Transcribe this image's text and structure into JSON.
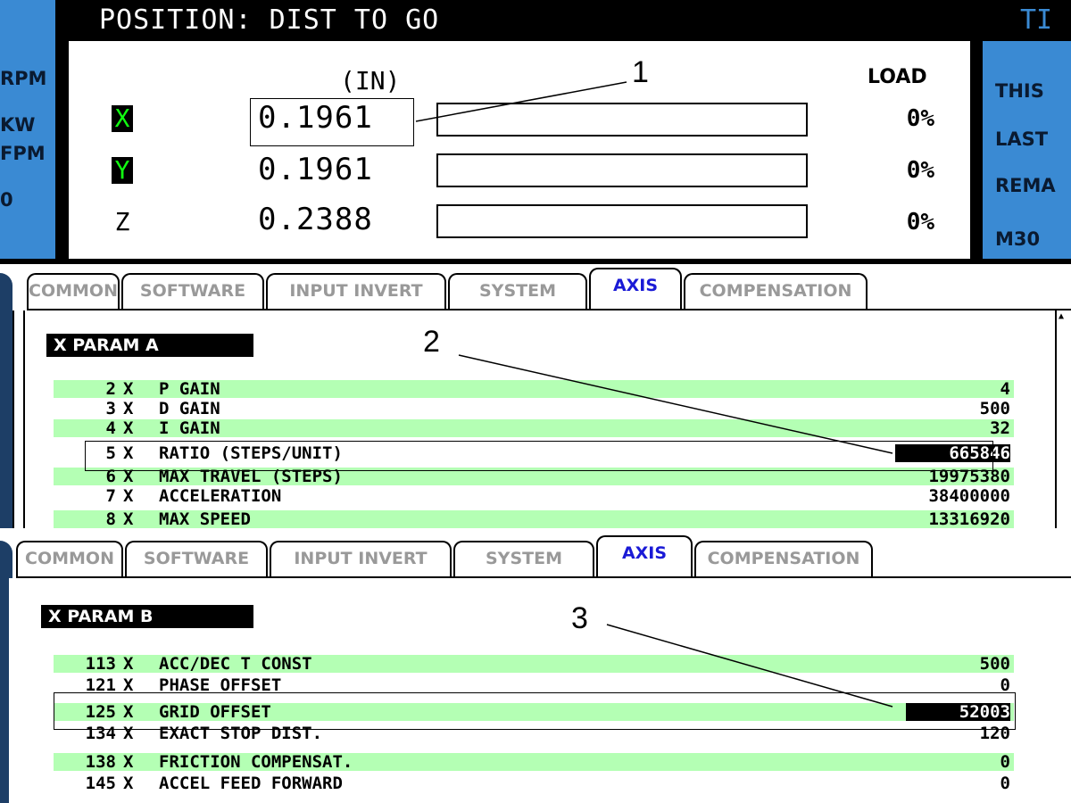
{
  "position_screen": {
    "title": "POSITION: DIST TO GO",
    "right_panel_title": "TI",
    "left_labels": [
      "RPM",
      "KW",
      "FPM",
      "0"
    ],
    "right_labels": [
      "THIS",
      "LAST",
      "REMA",
      "M30"
    ],
    "unit_header": "(IN)",
    "load_header": "LOAD",
    "axes": [
      {
        "letter": "X",
        "value": "0.1961",
        "load": "0%",
        "highlight": true
      },
      {
        "letter": "Y",
        "value": "0.1961",
        "load": "0%",
        "highlight": true
      },
      {
        "letter": "Z",
        "value": "0.2388",
        "load": "0%",
        "highlight": false
      }
    ]
  },
  "tabs": [
    "COMMON",
    "SOFTWARE",
    "INPUT INVERT",
    "SYSTEM",
    "AXIS",
    "COMPENSATION"
  ],
  "active_tab": "AXIS",
  "param_a": {
    "title": "X  PARAM  A",
    "rows": [
      {
        "num": "2",
        "axis": "X",
        "name": "P GAIN",
        "value": "4"
      },
      {
        "num": "3",
        "axis": "X",
        "name": "D GAIN",
        "value": "500"
      },
      {
        "num": "4",
        "axis": "X",
        "name": "I GAIN",
        "value": "32"
      },
      {
        "num": "5",
        "axis": "X",
        "name": "RATIO (STEPS/UNIT)",
        "value": "665846",
        "selected": true
      },
      {
        "num": "6",
        "axis": "X",
        "name": "MAX TRAVEL (STEPS)",
        "value": "19975380"
      },
      {
        "num": "7",
        "axis": "X",
        "name": "ACCELERATION",
        "value": "38400000"
      },
      {
        "num": "8",
        "axis": "X",
        "name": "MAX SPEED",
        "value": "13316920"
      }
    ]
  },
  "param_b": {
    "title": "X  PARAM  B",
    "rows": [
      {
        "num": "113",
        "axis": "X",
        "name": "ACC/DEC T CONST",
        "value": "500"
      },
      {
        "num": "121",
        "axis": "X",
        "name": "PHASE OFFSET",
        "value": "0"
      },
      {
        "num": "125",
        "axis": "X",
        "name": "GRID OFFSET",
        "value": "52003",
        "selected": true
      },
      {
        "num": "134",
        "axis": "X",
        "name": "EXACT STOP DIST.",
        "value": "120"
      },
      {
        "num": "138",
        "axis": "X",
        "name": "FRICTION COMPENSAT.",
        "value": "0"
      },
      {
        "num": "145",
        "axis": "X",
        "name": "ACCEL FEED FORWARD",
        "value": "0"
      }
    ]
  },
  "callouts": [
    "1",
    "2",
    "3"
  ],
  "colors": {
    "panel_blue": "#3a8ad3",
    "row_green": "#b4ffb4",
    "active_tab_text": "#1a1ad6",
    "axis_highlight": "#00ff00"
  }
}
